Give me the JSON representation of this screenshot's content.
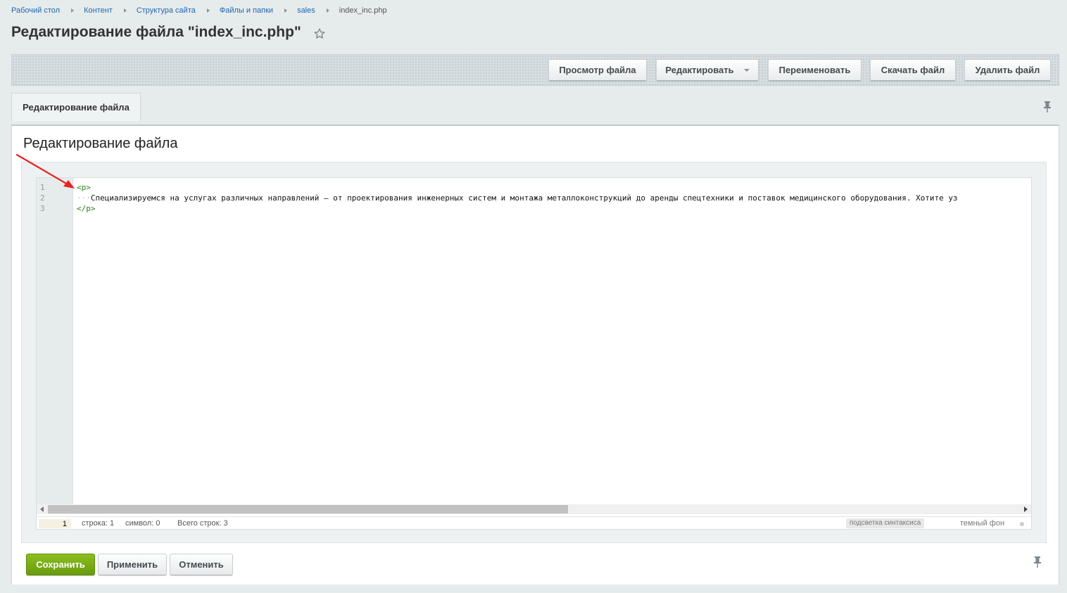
{
  "breadcrumb": {
    "items": [
      "Рабочий стол",
      "Контент",
      "Структура сайта",
      "Файлы и папки",
      "sales"
    ],
    "current": "index_inc.php"
  },
  "page": {
    "title": "Редактирование файла \"index_inc.php\"",
    "star_icon": "star-icon"
  },
  "toolbar": {
    "view_label": "Просмотр файла",
    "edit_label": "Редактировать",
    "rename_label": "Переименовать",
    "download_label": "Скачать файл",
    "delete_label": "Удалить файл"
  },
  "tabs": [
    {
      "label": "Редактирование файла",
      "active": true
    }
  ],
  "section": {
    "title": "Редактирование файла"
  },
  "editor": {
    "line_numbers": [
      "1",
      "2",
      "3"
    ],
    "lines": {
      "l1": "<p>",
      "l2_indent": "···",
      "l2_text": "Специализируемся на услугах различных направлений – от проектирования инженерных систем и монтажа металлоконструкций до аренды спецтехники и поставок медицинского оборудования. Хотите уз",
      "l3": "</p>"
    },
    "tag_color": "#2a7f1b"
  },
  "statusbar": {
    "goto_line_value": "1",
    "row_label": "строка: 1",
    "char_label": "символ: 0",
    "total_label": "Всего строк: 3",
    "syntax_toggle": "подсветка синтаксиса",
    "dark_toggle": "темный фон"
  },
  "footer": {
    "save_label": "Сохранить",
    "apply_label": "Применить",
    "cancel_label": "Отменить"
  },
  "colors": {
    "background": "#e6ebec",
    "link": "#2067b0",
    "save_button": "#7aad16",
    "annotation_arrow": "#e52323"
  }
}
